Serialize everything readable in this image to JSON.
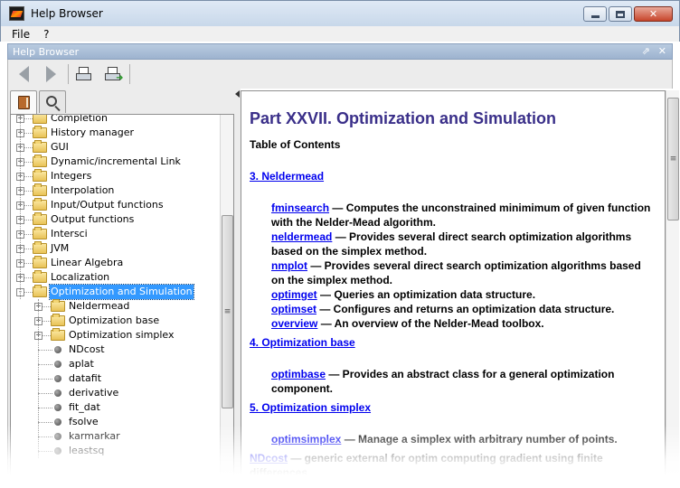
{
  "window": {
    "title": "Help Browser"
  },
  "menu": [
    "File",
    "?"
  ],
  "dock": {
    "title": "Help Browser"
  },
  "toolbar": {
    "back_icon": "back-arrow-icon",
    "forward_icon": "forward-arrow-icon",
    "print_icon": "print-icon",
    "print_preview_icon": "print-preview-icon"
  },
  "nav_tabs": [
    {
      "icon": "book-icon",
      "active": true
    },
    {
      "icon": "search-icon",
      "active": false
    }
  ],
  "tree": [
    {
      "label": "Completion",
      "depth": 0,
      "kind": "folder",
      "expander": "+"
    },
    {
      "label": "History manager",
      "depth": 0,
      "kind": "folder",
      "expander": "+"
    },
    {
      "label": "GUI",
      "depth": 0,
      "kind": "folder",
      "expander": "+"
    },
    {
      "label": "Dynamic/incremental Link",
      "depth": 0,
      "kind": "folder",
      "expander": "+"
    },
    {
      "label": "Integers",
      "depth": 0,
      "kind": "folder",
      "expander": "+"
    },
    {
      "label": "Interpolation",
      "depth": 0,
      "kind": "folder",
      "expander": "+"
    },
    {
      "label": "Input/Output functions",
      "depth": 0,
      "kind": "folder",
      "expander": "+"
    },
    {
      "label": "Output functions",
      "depth": 0,
      "kind": "folder",
      "expander": "+"
    },
    {
      "label": "Intersci",
      "depth": 0,
      "kind": "folder",
      "expander": "+"
    },
    {
      "label": "JVM",
      "depth": 0,
      "kind": "folder",
      "expander": "+"
    },
    {
      "label": "Linear Algebra",
      "depth": 0,
      "kind": "folder",
      "expander": "+"
    },
    {
      "label": "Localization",
      "depth": 0,
      "kind": "folder",
      "expander": "+"
    },
    {
      "label": "Optimization and Simulation",
      "depth": 0,
      "kind": "folder",
      "expander": "-",
      "selected": true
    },
    {
      "label": "Neldermead",
      "depth": 1,
      "kind": "folder",
      "expander": "+"
    },
    {
      "label": "Optimization base",
      "depth": 1,
      "kind": "folder",
      "expander": "+"
    },
    {
      "label": "Optimization simplex",
      "depth": 1,
      "kind": "folder",
      "expander": "+"
    },
    {
      "label": "NDcost",
      "depth": 1,
      "kind": "leaf"
    },
    {
      "label": "aplat",
      "depth": 1,
      "kind": "leaf"
    },
    {
      "label": "datafit",
      "depth": 1,
      "kind": "leaf"
    },
    {
      "label": "derivative",
      "depth": 1,
      "kind": "leaf"
    },
    {
      "label": "fit_dat",
      "depth": 1,
      "kind": "leaf"
    },
    {
      "label": "fsolve",
      "depth": 1,
      "kind": "leaf"
    },
    {
      "label": "karmarkar",
      "depth": 1,
      "kind": "leaf"
    },
    {
      "label": "leastsq",
      "depth": 1,
      "kind": "leaf"
    }
  ],
  "content": {
    "title": "Part XXVII. Optimization and Simulation",
    "toc_heading": "Table of Contents",
    "sections": [
      {
        "heading": "3. Neldermead",
        "entries": [
          {
            "name": "fminsearch",
            "desc": " — Computes the unconstrained minimimum of given function with the Nelder-Mead algorithm."
          },
          {
            "name": "neldermead",
            "desc": " — Provides several direct search optimization algorithms based on the simplex method."
          },
          {
            "name": "nmplot",
            "desc": " — Provides several direct search optimization algorithms based on the simplex method."
          },
          {
            "name": "optimget",
            "desc": " — Queries an optimization data structure."
          },
          {
            "name": "optimset",
            "desc": " — Configures and returns an optimization data structure."
          },
          {
            "name": "overview",
            "desc": " — An overview of the Nelder-Mead toolbox."
          }
        ]
      },
      {
        "heading": "4. Optimization base",
        "entries": [
          {
            "name": "optimbase",
            "desc": " — Provides an abstract class for a general optimization component."
          }
        ]
      },
      {
        "heading": "5. Optimization simplex",
        "entries": [
          {
            "name": "optimsimplex",
            "desc": " — Manage a simplex with arbitrary number of points."
          }
        ]
      }
    ],
    "trailing": {
      "name": "NDcost",
      "desc": " — generic external for optim computing gradient using finite differences"
    }
  }
}
